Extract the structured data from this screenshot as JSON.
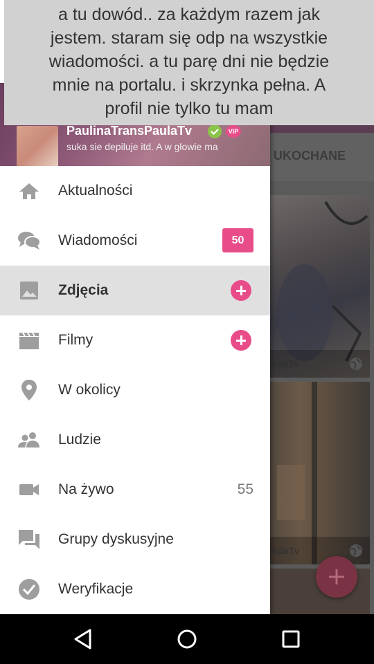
{
  "toast": {
    "lines": [
      "a tu dowód.. za każdym razem jak",
      "jestem. staram się odp na wszystkie",
      "wiadomości. a tu parę dni nie będzie",
      "mnie na portalu. i skrzynka pełna. A",
      "profil nie tylko tu mam"
    ]
  },
  "profile": {
    "name": "PaulinaTransPaulaTv",
    "vip_label": "VIP",
    "status": "suka sie depiluje itd. A w głowie ma"
  },
  "background": {
    "tab_label": "UKOCHANE",
    "photo_captions": [
      "aulaTv",
      "aulaTv"
    ]
  },
  "menu": {
    "items": [
      {
        "label": "Aktualności",
        "icon": "home-icon"
      },
      {
        "label": "Wiadomości",
        "icon": "chat-bubbles-icon",
        "badge": "50"
      },
      {
        "label": "Zdjęcia",
        "icon": "image-icon",
        "active": true,
        "add": true
      },
      {
        "label": "Filmy",
        "icon": "film-icon",
        "add": true
      },
      {
        "label": "W okolicy",
        "icon": "location-pin-icon"
      },
      {
        "label": "Ludzie",
        "icon": "people-icon"
      },
      {
        "label": "Na żywo",
        "icon": "video-camera-icon",
        "count": "55"
      },
      {
        "label": "Grupy dyskusyjne",
        "icon": "forum-icon"
      },
      {
        "label": "Weryfikacje",
        "icon": "check-circle-icon"
      }
    ]
  },
  "colors": {
    "accent": "#e84d8a",
    "active_row": "#e0e0e0",
    "icon_gray": "#9e9e9e",
    "toast_bg": "#d1d1d1"
  }
}
